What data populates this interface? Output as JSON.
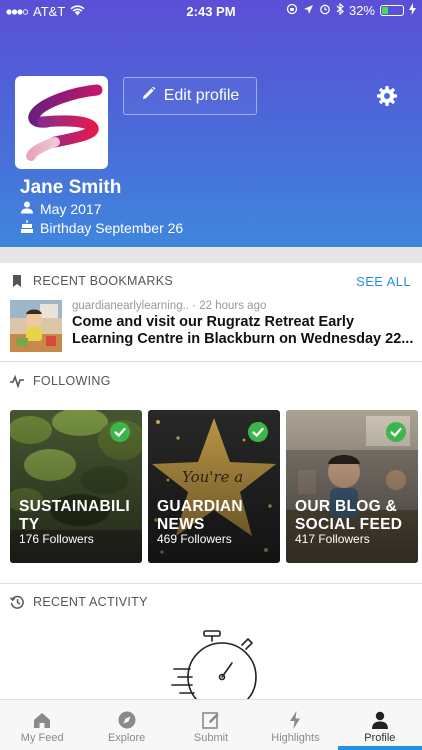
{
  "status_bar": {
    "carrier": "AT&T",
    "time": "2:43 PM",
    "battery_percent": "32%",
    "battery_level": 0.32
  },
  "profile": {
    "edit_label": "Edit profile",
    "name": "Jane Smith",
    "joined": "May 2017",
    "birthday": "Birthday September 26"
  },
  "bookmarks": {
    "heading": "RECENT BOOKMARKS",
    "see_all": "SEE ALL",
    "items": [
      {
        "source": "guardianearlylearning..",
        "time": "· 22 hours ago",
        "title": "Come and visit our Rugratz Retreat Early Learning Centre in Blackburn on Wednesday 22..."
      }
    ]
  },
  "following": {
    "heading": "FOLLOWING",
    "cards": [
      {
        "title": "SUSTAINABILITY",
        "followers": "176 Followers"
      },
      {
        "title": "GUARDIAN NEWS",
        "followers": "469 Followers"
      },
      {
        "title": "OUR BLOG & SOCIAL FEED",
        "followers": "417 Followers"
      }
    ]
  },
  "activity": {
    "heading": "RECENT ACTIVITY"
  },
  "tabs": [
    {
      "label": "My Feed",
      "icon": "home-icon",
      "active": false
    },
    {
      "label": "Explore",
      "icon": "compass-icon",
      "active": false
    },
    {
      "label": "Submit",
      "icon": "edit-icon",
      "active": false
    },
    {
      "label": "Highlights",
      "icon": "lightning-icon",
      "active": false
    },
    {
      "label": "Profile",
      "icon": "person-icon",
      "active": true
    }
  ],
  "colors": {
    "header_top": "#5b4fd6",
    "header_bottom": "#3f86dd",
    "accent": "#2a8fd8",
    "check": "#3cb54a"
  }
}
